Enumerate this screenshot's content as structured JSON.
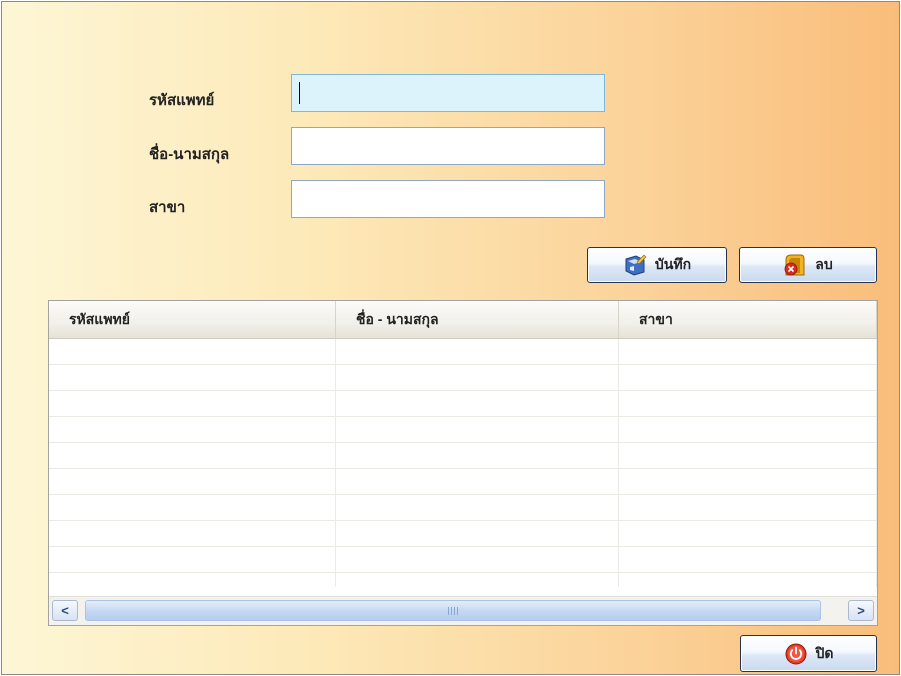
{
  "form": {
    "doctor_id_label": "รหัสแพทย์",
    "doctor_id_value": "",
    "name_label": "ชื่อ-นามสกุล",
    "name_value": "",
    "branch_label": "สาขา",
    "branch_value": ""
  },
  "actions": {
    "save_label": "บันทึก",
    "save_icon": "save-disk-icon",
    "delete_label": "ลบ",
    "delete_icon": "delete-icon",
    "close_label": "ปิด",
    "close_icon": "power-icon"
  },
  "grid": {
    "columns": [
      "รหัสแพทย์",
      "ชื่อ - นามสกุล",
      "สาขา"
    ],
    "rows": [
      [
        "",
        "",
        ""
      ],
      [
        "",
        "",
        ""
      ],
      [
        "",
        "",
        ""
      ],
      [
        "",
        "",
        ""
      ],
      [
        "",
        "",
        ""
      ],
      [
        "",
        "",
        ""
      ],
      [
        "",
        "",
        ""
      ],
      [
        "",
        "",
        ""
      ],
      [
        "",
        "",
        ""
      ],
      [
        "",
        "",
        ""
      ]
    ],
    "scroll_left_glyph": "<",
    "scroll_right_glyph": ">"
  },
  "colors": {
    "background_left": "#fdf6d6",
    "background_right": "#f9bd7a",
    "focused_field": "#dcf3fc"
  }
}
